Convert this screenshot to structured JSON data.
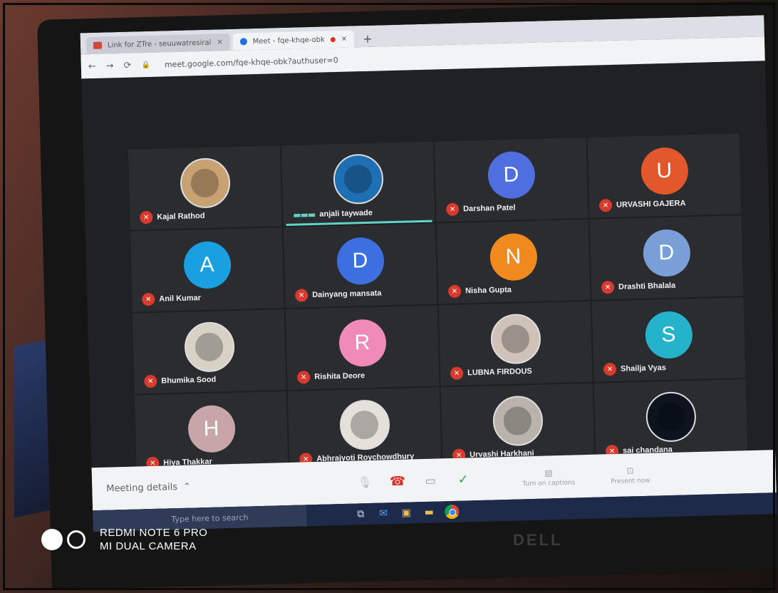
{
  "browser": {
    "tabs": [
      {
        "label": "Link for ZTre - seuuwatresiral",
        "icon": "gmail-icon",
        "active": false
      },
      {
        "label": "Meet - fqe-khqe-obk",
        "icon": "meet-icon",
        "active": true
      }
    ],
    "url": "meet.google.com/fqe-khqe-obk?authuser=0"
  },
  "participants": [
    {
      "name": "Kajal Rathod",
      "initial": "",
      "color": "#c9a273",
      "photo": true,
      "speaking": false
    },
    {
      "name": "anjali taywade",
      "initial": "",
      "color": "#1f6fb5",
      "photo": true,
      "speaking": true
    },
    {
      "name": "Darshan Patel",
      "initial": "D",
      "color": "#4f6fe0",
      "photo": false,
      "speaking": false
    },
    {
      "name": "URVASHI GAJERA",
      "initial": "U",
      "color": "#e2572b",
      "photo": false,
      "speaking": false
    },
    {
      "name": "Anil Kumar",
      "initial": "A",
      "color": "#1aa0e0",
      "photo": false,
      "speaking": false
    },
    {
      "name": "Dainyang mansata",
      "initial": "D",
      "color": "#3d6fe0",
      "photo": false,
      "speaking": false
    },
    {
      "name": "Nisha Gupta",
      "initial": "N",
      "color": "#f08a1e",
      "photo": false,
      "speaking": false
    },
    {
      "name": "Drashti Bhalala",
      "initial": "D",
      "color": "#7a9fd6",
      "photo": false,
      "speaking": false
    },
    {
      "name": "Bhumika Sood",
      "initial": "",
      "color": "#d8d2c6",
      "photo": true,
      "speaking": false
    },
    {
      "name": "Rishita Deore",
      "initial": "R",
      "color": "#f08ab8",
      "photo": false,
      "speaking": false
    },
    {
      "name": "LUBNA FIRDOUS",
      "initial": "",
      "color": "#cfc2b8",
      "photo": true,
      "speaking": false
    },
    {
      "name": "Shailja Vyas",
      "initial": "S",
      "color": "#25b3cc",
      "photo": false,
      "speaking": false
    },
    {
      "name": "Hiya Thakkar",
      "initial": "H",
      "color": "#c8a6a8",
      "photo": false,
      "speaking": false
    },
    {
      "name": "Abhrajyoti Roychowdhury",
      "initial": "",
      "color": "#e5e1da",
      "photo": true,
      "speaking": false
    },
    {
      "name": "Urvashi Harkhani",
      "initial": "",
      "color": "#b9b3ab",
      "photo": true,
      "speaking": false
    },
    {
      "name": "sai chandana",
      "initial": "",
      "color": "#0e1320",
      "photo": true,
      "speaking": false
    }
  ],
  "controls": {
    "meeting_details": "Meeting details",
    "captions": "Turn on captions",
    "present": "Present now"
  },
  "taskbar": {
    "search_placeholder": "Type here to search"
  },
  "monitor_brand": "DELL",
  "watermark": {
    "line1": "REDMI NOTE 6 PRO",
    "line2": "MI DUAL CAMERA"
  }
}
